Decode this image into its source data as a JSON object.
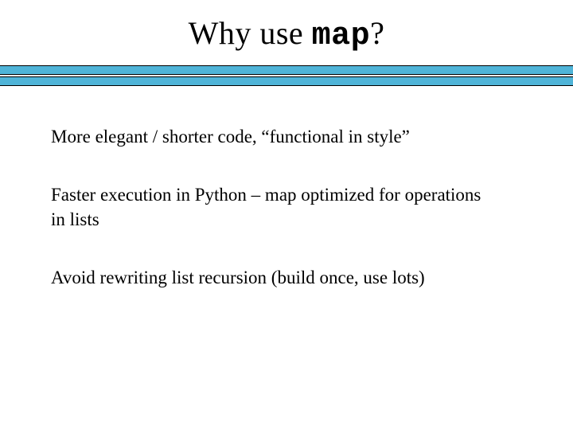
{
  "title": {
    "prefix": "Why use ",
    "code": "map",
    "suffix": "?"
  },
  "bullets": [
    "More elegant / shorter code, “functional in style”",
    "Faster execution in Python – map optimized for operations in lists",
    "Avoid rewriting list recursion (build once, use lots)"
  ]
}
